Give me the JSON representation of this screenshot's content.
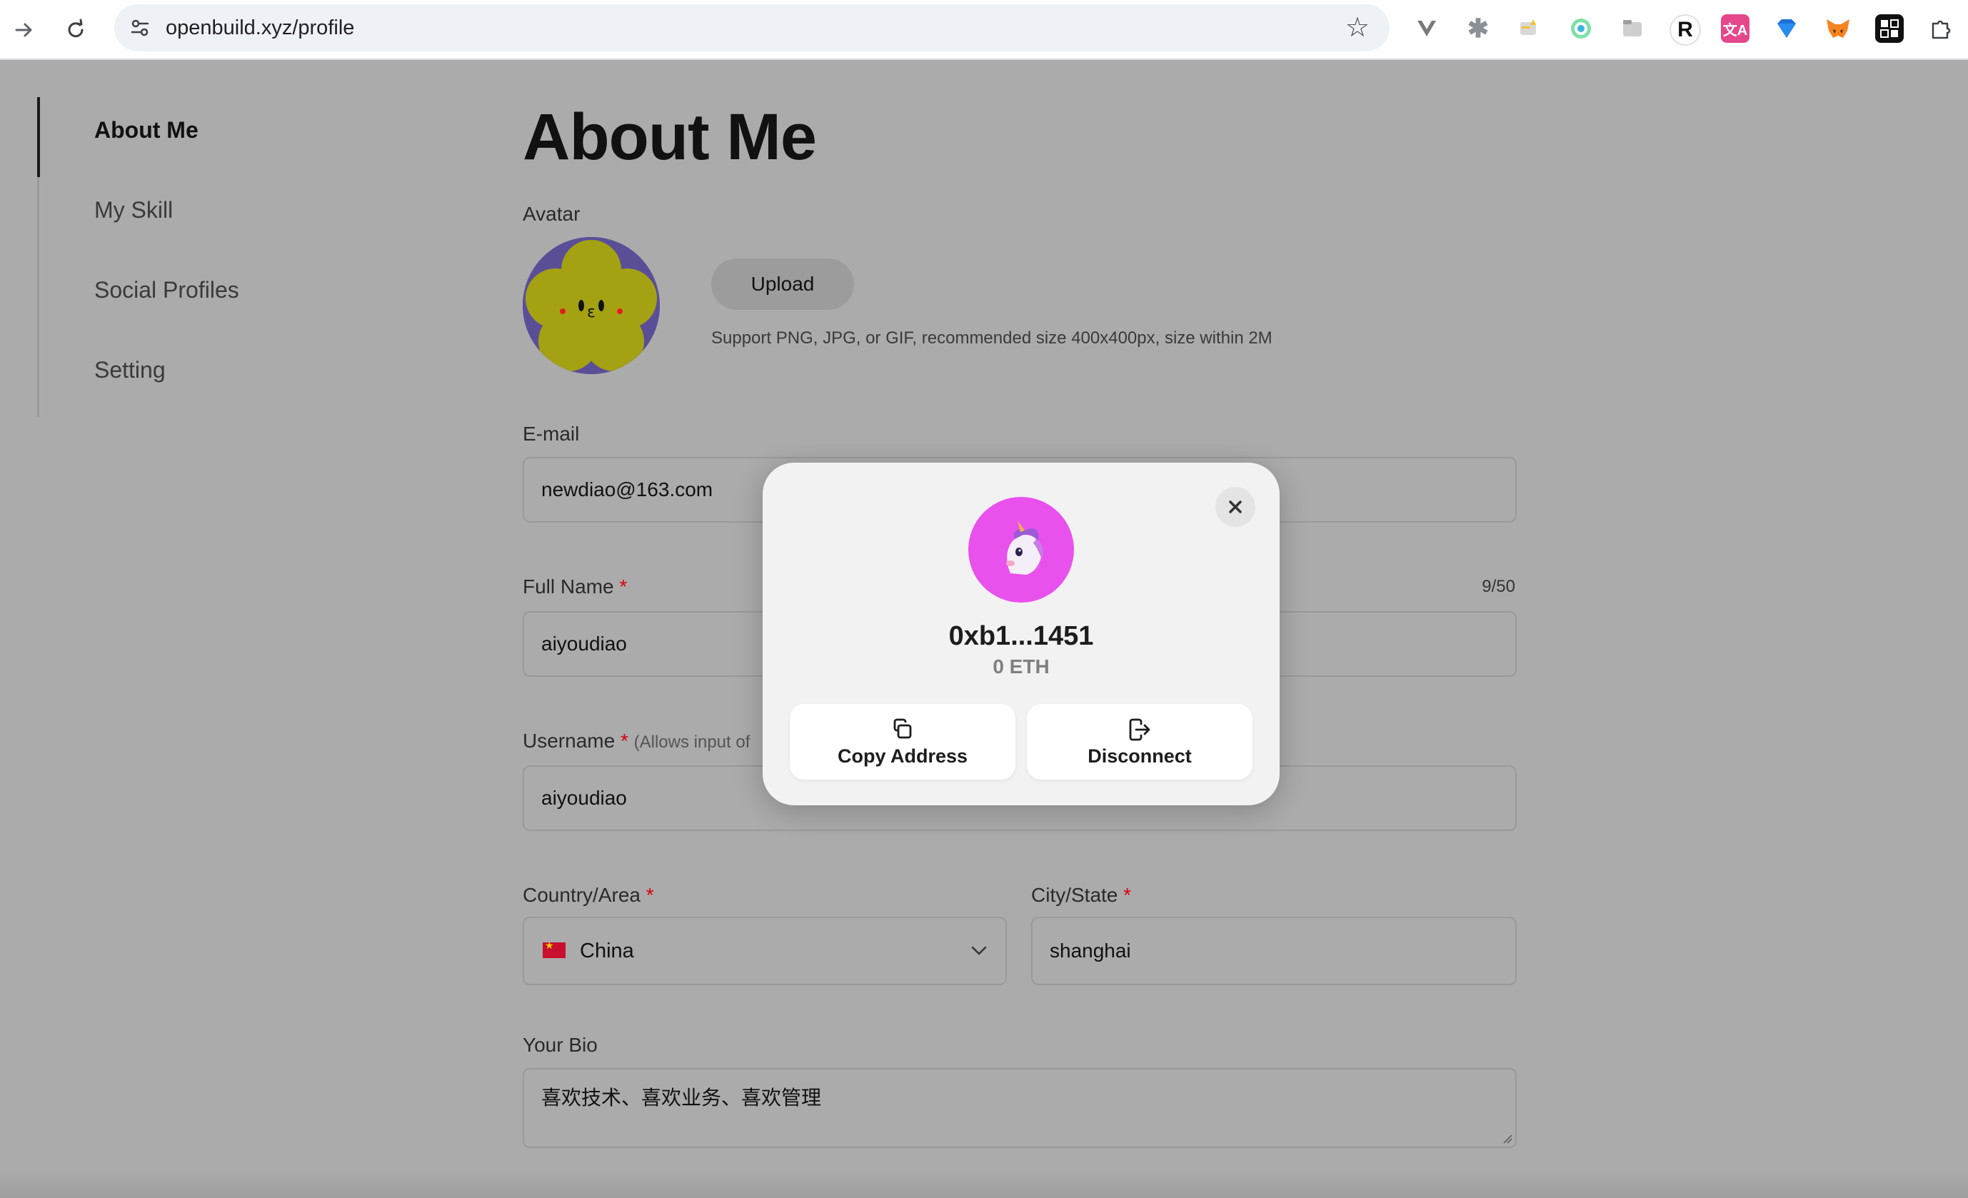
{
  "browser": {
    "url": "openbuild.xyz/profile",
    "extensions": [
      "vue-devtools-icon",
      "asterisk-icon",
      "highlighter-icon",
      "circle-target-icon",
      "tab-icon",
      "r-extension-icon",
      "translate-icon",
      "diamond-icon",
      "metamask-fox-icon",
      "dice-icon",
      "puzzle-icon"
    ],
    "colors": {
      "chrome_bg": "#ffffff",
      "omnibox_bg": "#eef1f6"
    }
  },
  "sidebar": {
    "items": [
      {
        "label": "About Me",
        "active": true
      },
      {
        "label": "My Skill",
        "active": false
      },
      {
        "label": "Social Profiles",
        "active": false
      },
      {
        "label": "Setting",
        "active": false
      }
    ]
  },
  "main": {
    "title": "About Me",
    "avatar": {
      "label": "Avatar",
      "upload_label": "Upload",
      "hint": "Support PNG, JPG, or GIF, recommended size 400x400px, size within 2M"
    },
    "email": {
      "label": "E-mail",
      "value": "newdiao@163.com"
    },
    "full_name": {
      "label": "Full Name",
      "required": "*",
      "value": "aiyoudiao",
      "counter": "9/50"
    },
    "username": {
      "label": "Username",
      "required": "*",
      "hint": "(Allows input of",
      "value": "aiyoudiao"
    },
    "country": {
      "label": "Country/Area",
      "required": "*",
      "value": "China"
    },
    "city": {
      "label": "City/State",
      "required": "*",
      "value": "shanghai"
    },
    "bio": {
      "label": "Your Bio",
      "value": "喜欢技术、喜欢业务、喜欢管理"
    }
  },
  "modal": {
    "address": "0xb1...1451",
    "balance": "0 ETH",
    "copy_label": "Copy Address",
    "disconnect_label": "Disconnect",
    "avatar_color": "#e951ed"
  },
  "colors": {
    "overlay_bg": "#ababab",
    "required": "#d8000c",
    "modal_bg": "#f2f2f2"
  }
}
